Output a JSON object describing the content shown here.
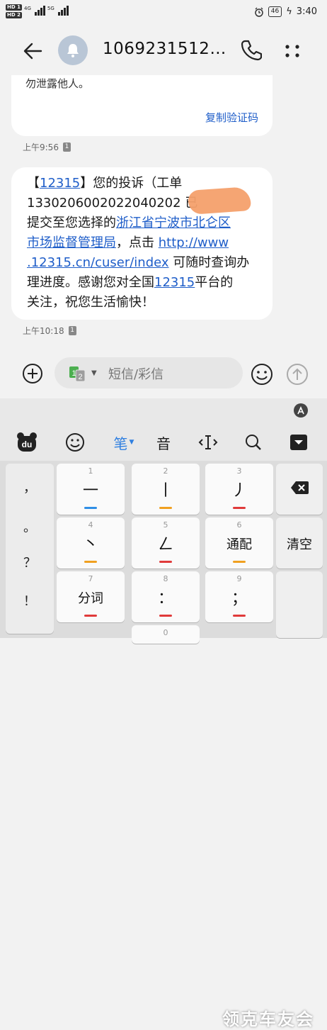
{
  "status_bar": {
    "sim1": "HD 1",
    "sim2": "HD 2",
    "network1": "4G",
    "network2": "5G",
    "battery": "46",
    "time": "3:40"
  },
  "header": {
    "title": "1069231512…"
  },
  "messages": [
    {
      "text": "勿泄露他人。",
      "action": "复制验证码",
      "time": "上午9:56",
      "sim": "1"
    },
    {
      "lines": [
        {
          "parts": [
            {
              "t": "【",
              "link": false
            },
            {
              "t": "12315",
              "link": true
            },
            {
              "t": "】您的投诉（工单",
              "link": false
            }
          ]
        },
        {
          "parts": [
            {
              "t": "1330206002022040202",
              "link": false
            },
            {
              "t": "          已",
              "link": false
            }
          ]
        },
        {
          "parts": [
            {
              "t": "提交至您选择的",
              "link": false
            },
            {
              "t": "浙江省宁波市北仑区",
              "link": true
            }
          ]
        },
        {
          "parts": [
            {
              "t": "市场监督管理局",
              "link": true
            },
            {
              "t": "，点击 ",
              "link": false
            },
            {
              "t": "http://www",
              "link": true
            }
          ]
        },
        {
          "parts": [
            {
              "t": ".12315.cn/cuser/index",
              "link": true
            },
            {
              "t": " 可随时查询办",
              "link": false
            }
          ]
        },
        {
          "parts": [
            {
              "t": "理进度。感谢您对全国",
              "link": false
            },
            {
              "t": "12315",
              "link": true
            },
            {
              "t": "平台的",
              "link": false
            }
          ]
        },
        {
          "parts": [
            {
              "t": "关注，祝您生活愉快！",
              "link": false
            }
          ]
        }
      ],
      "time": "上午10:18",
      "sim": "1"
    }
  ],
  "input": {
    "placeholder": "短信/彩信",
    "sim_label": "1 2"
  },
  "keyboard": {
    "toolbar": {
      "logo": "du",
      "pen_label": "笔",
      "sound_label": "音"
    },
    "left_punct": [
      "，",
      "。",
      "？",
      "！"
    ],
    "keys": [
      {
        "num": "1",
        "char": "一",
        "color": "#2f8ee6"
      },
      {
        "num": "2",
        "char": "丨",
        "color": "#f0a020"
      },
      {
        "num": "3",
        "char": "丿",
        "color": "#e03a3a"
      },
      {
        "num": "4",
        "char": "丶",
        "color": "#f0a020"
      },
      {
        "num": "5",
        "char": "ㄥ",
        "color": "#e03a3a"
      },
      {
        "num": "6",
        "char": "通配",
        "color": "#f0a020"
      },
      {
        "num": "7",
        "char": "分词",
        "color": "#e03a3a"
      },
      {
        "num": "8",
        "char": "：",
        "color": "#e03a3a"
      },
      {
        "num": "9",
        "char": "；",
        "color": "#e03a3a"
      },
      {
        "num": "",
        "char": "",
        "color": ""
      },
      {
        "num": "0",
        "char": "",
        "color": "#2f8ee6"
      }
    ],
    "clear_label": "清空"
  },
  "watermark": "领克车友会"
}
